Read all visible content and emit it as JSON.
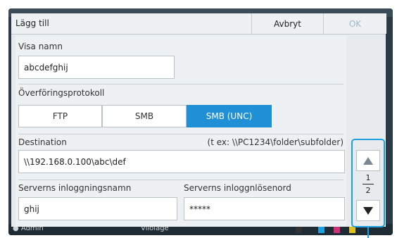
{
  "dialog": {
    "title": "Lägg till",
    "cancel_label": "Avbryt",
    "ok_label": "OK"
  },
  "display_name": {
    "label": "Visa namn",
    "value": "abcdefghij"
  },
  "protocol": {
    "label": "Överföringsprotokoll",
    "options": [
      "FTP",
      "SMB",
      "SMB (UNC)"
    ],
    "selected": "SMB (UNC)"
  },
  "destination": {
    "label": "Destination",
    "hint": "(t ex: \\\\PC1234\\folder\\subfolder)",
    "value": "\\\\192.168.0.100\\abc\\def"
  },
  "login": {
    "label": "Serverns inloggningsnamn",
    "value": "ghij"
  },
  "password": {
    "label": "Serverns inloggnlösenord",
    "value": "*****"
  },
  "pager": {
    "current": "1",
    "total": "2"
  },
  "status": {
    "user": "Admin",
    "mode": "Viloläge"
  },
  "colors": {
    "accent": "#1f8fd6",
    "highlight": "#1ea0e0"
  }
}
